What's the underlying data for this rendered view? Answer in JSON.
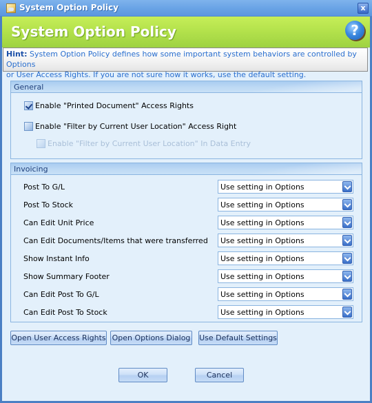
{
  "window": {
    "title": "System Option Policy",
    "close_label": "x"
  },
  "header": {
    "title": "System Option Policy",
    "help_label": "?"
  },
  "hint": {
    "label": "Hint:",
    "text": "System Option Policy defines how some important system behaviors are controlled by Options\n      or User Access Rights. If you are not sure how it works, use the default setting."
  },
  "general": {
    "title": "General",
    "options": [
      {
        "label": "Enable \"Printed Document\" Access Rights",
        "checked": true,
        "enabled": true
      },
      {
        "label": "Enable \"Filter by Current User Location\" Access Right",
        "checked": false,
        "enabled": true
      },
      {
        "label": "Enable \"Filter by Current User Location\" In Data Entry",
        "checked": false,
        "enabled": false
      }
    ]
  },
  "invoicing": {
    "title": "Invoicing",
    "rows": [
      {
        "label": "Post To G/L",
        "value": "Use setting in Options"
      },
      {
        "label": "Post To Stock",
        "value": "Use setting in Options"
      },
      {
        "label": "Can Edit Unit Price",
        "value": "Use setting in Options"
      },
      {
        "label": "Can Edit Documents/Items that were transferred",
        "value": "Use setting in Options"
      },
      {
        "label": "Show Instant Info",
        "value": "Use setting in Options"
      },
      {
        "label": "Show Summary Footer",
        "value": "Use setting in Options"
      },
      {
        "label": "Can Edit Post To G/L",
        "value": "Use setting in Options"
      },
      {
        "label": "Can Edit Post To Stock",
        "value": "Use setting in Options"
      }
    ]
  },
  "actions": {
    "open_user_access_rights": "Open User Access Rights",
    "open_options_dialog": "Open Options Dialog",
    "use_default_settings": "Use Default Settings",
    "ok": "OK",
    "cancel": "Cancel"
  }
}
